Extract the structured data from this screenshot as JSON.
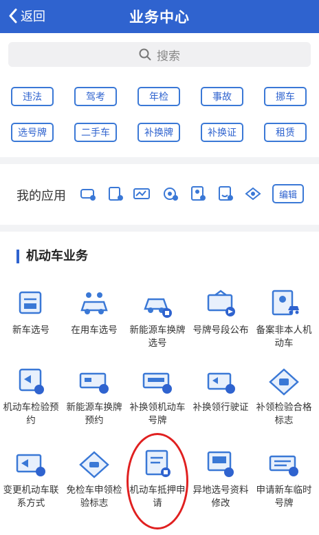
{
  "header": {
    "back_label": "返回",
    "title": "业务中心"
  },
  "search": {
    "placeholder": "搜索"
  },
  "quick_chips": [
    "违法",
    "驾考",
    "年检",
    "事故",
    "挪车",
    "选号牌",
    "二手车",
    "补换牌",
    "补换证",
    "租赁"
  ],
  "my_apps": {
    "label": "我的应用",
    "edit_label": "编辑"
  },
  "section": {
    "title": "机动车业务"
  },
  "services": [
    {
      "label": "新车选号",
      "icon": "id-card-icon"
    },
    {
      "label": "在用车选号",
      "icon": "car-people-icon"
    },
    {
      "label": "新能源车换牌选号",
      "icon": "ev-car-icon"
    },
    {
      "label": "号牌号段公布",
      "icon": "sign-board-icon"
    },
    {
      "label": "备案非本人机动车",
      "icon": "profile-car-icon"
    },
    {
      "label": "机动车检验预约",
      "icon": "calendar-arrow-icon"
    },
    {
      "label": "新能源车换牌预约",
      "icon": "plate-card-icon"
    },
    {
      "label": "补换领机动车号牌",
      "icon": "plate-lock-icon"
    },
    {
      "label": "补换领行驶证",
      "icon": "license-arrow-icon"
    },
    {
      "label": "补领检验合格标志",
      "icon": "diamond-badge-icon"
    },
    {
      "label": "变更机动车联系方式",
      "icon": "contact-arrow-icon"
    },
    {
      "label": "免检车申领检验标志",
      "icon": "diamond-card-icon"
    },
    {
      "label": "机动车抵押申请",
      "icon": "document-lock-icon"
    },
    {
      "label": "异地选号资料修改",
      "icon": "edit-document-icon"
    },
    {
      "label": "申请新车临时号牌",
      "icon": "temp-plate-icon"
    }
  ],
  "colors": {
    "brand": "#2f63cf",
    "chip_border": "#3a78d6",
    "highlight": "#e02020"
  }
}
